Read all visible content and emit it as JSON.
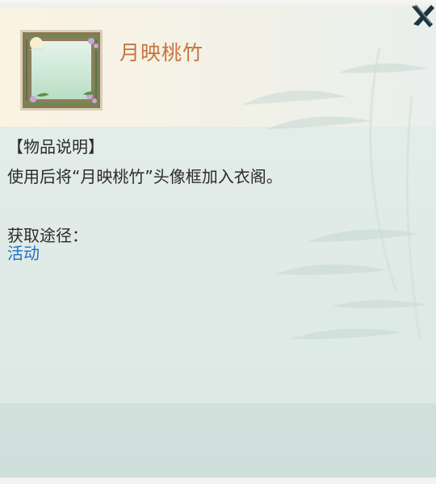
{
  "item": {
    "name": "月映桃竹",
    "frame_icon": "avatar-frame-bamboo-peach-blossom-icon"
  },
  "description": {
    "header": "【物品说明】",
    "text": "使用后将“月映桃竹”头像框加入衣阁。"
  },
  "source": {
    "label": "获取途径：",
    "link": "活动"
  },
  "close_icon": "close-x-icon",
  "colors": {
    "item_name": "#c9743e",
    "body_text": "#2b2b2b",
    "link": "#1d6fc6",
    "panel_bg": "#e3ece8",
    "header_bg": "#fbf3e2",
    "footer_bg": "#d2e0dc",
    "close_icon": "#1e3540"
  }
}
